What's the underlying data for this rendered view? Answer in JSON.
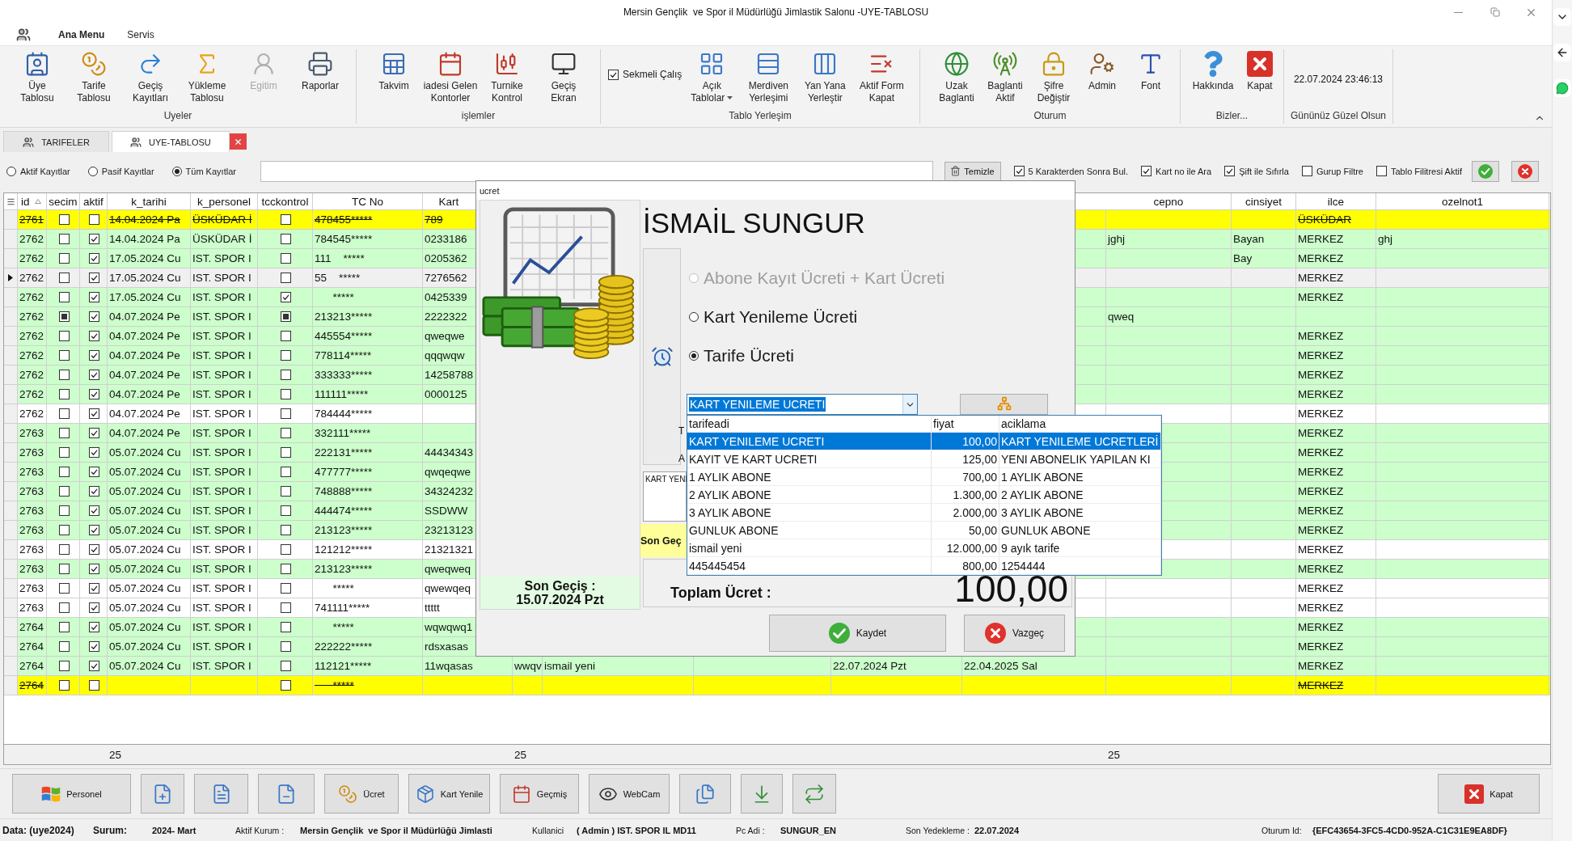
{
  "window": {
    "title": "Mersin Gençlik  ve Spor il Müdürlüğü Jimlastik Salonu -UYE-TABLOSU"
  },
  "menu": [
    {
      "label": "Ana Menu",
      "selected": true
    },
    {
      "label": "Servis",
      "selected": false
    }
  ],
  "ribbon": {
    "groups": [
      {
        "label": "Uyeler",
        "items": [
          {
            "label": "Üye\nTablosu",
            "disabled": false
          },
          {
            "label": "Tarife\nTablosu",
            "disabled": false
          },
          {
            "label": "Geçiş\nKayıtları",
            "disabled": false
          },
          {
            "label": "Yükleme\nTablosu",
            "disabled": false
          },
          {
            "label": "Egitim",
            "disabled": true
          },
          {
            "label": "Raporlar",
            "disabled": false
          }
        ]
      },
      {
        "label": "işlemler",
        "items": [
          {
            "label": "Takvim"
          },
          {
            "label": "iadesi Gelen\nKontorler"
          },
          {
            "label": "Turnike\nKontrol"
          },
          {
            "label": "Geçiş\nEkran"
          }
        ]
      },
      {
        "label": "Tablo Yerleşim",
        "checkbox": {
          "label": "Sekmeli Çalış",
          "checked": true
        },
        "items": [
          {
            "label": "Açık\nTablolar",
            "dropdown": true
          },
          {
            "label": "Merdiven\nYerleşimi",
            "dropdown": false
          },
          {
            "label": "Yan Yana\nYerleştir",
            "dropdown": false
          },
          {
            "label": "Aktif Form\nKapat",
            "dropdown": false
          }
        ]
      },
      {
        "label": "Oturum",
        "items": [
          {
            "label": "Uzak\nBaglanti"
          },
          {
            "label": "Baglanti\nAktif"
          },
          {
            "label": "Şifre\nDeğiştir"
          },
          {
            "label": "Admin"
          },
          {
            "label": "Font"
          }
        ]
      },
      {
        "label": "Bizler...",
        "items": [
          {
            "label": "Hakkında"
          },
          {
            "label": "Kapat"
          }
        ]
      },
      {
        "label": "Gününüz Güzel Olsun",
        "clock": "22.07.2024 23:46:13"
      }
    ]
  },
  "tabs": [
    {
      "label": "TARIFELER",
      "selected": false
    },
    {
      "label": "UYE-TABLOSU",
      "selected": true
    }
  ],
  "filters": {
    "radios": [
      {
        "label": "Aktif Kayıtlar",
        "selected": false
      },
      {
        "label": "Pasif Kayıtlar",
        "selected": false
      },
      {
        "label": "Tüm Kayıtlar",
        "selected": true
      }
    ],
    "clear_button": "Temizle",
    "checkboxes": [
      {
        "label": "5 Karakterden Sonra Bul.",
        "checked": true
      },
      {
        "label": "Kart no ile Ara",
        "checked": true
      },
      {
        "label": "Şift ile Sıfırla",
        "checked": true
      },
      {
        "label": "Gurup Filtre",
        "checked": false
      },
      {
        "label": "Tablo Filitresi Aktif",
        "checked": false
      }
    ]
  },
  "table": {
    "columns": {
      "id": {
        "label": "id",
        "kind": "text",
        "sorted": true
      },
      "secim": {
        "label": "secim",
        "kind": "checkbox"
      },
      "aktif": {
        "label": "aktif",
        "kind": "checkbox"
      },
      "k_tarihi": {
        "label": "k_tarihi",
        "kind": "text",
        "footer": "25"
      },
      "k_personel": {
        "label": "k_personel",
        "kind": "text"
      },
      "tcckontrol": {
        "label": "tcckontrol",
        "kind": "checkbox"
      },
      "tc_no": {
        "label": "TC No",
        "kind": "text"
      },
      "kart": {
        "label": "Kart",
        "kind": "text"
      },
      "column_9": {
        "kind": "text",
        "footer": "25"
      },
      "column_10": {
        "kind": "text"
      },
      "column_11": {
        "kind": "text"
      },
      "column_12": {
        "kind": "text"
      },
      "column_13": {
        "kind": "text"
      },
      "cepno": {
        "label": "cepno",
        "kind": "text",
        "footer": "25"
      },
      "cinsiyet": {
        "label": "cinsiyet",
        "kind": "text"
      },
      "ilce": {
        "label": "ilce",
        "kind": "text"
      },
      "ozelnot1": {
        "label": "ozelnot1",
        "kind": "text"
      }
    },
    "rows": [
      {
        "color": "#ffff00",
        "struck": true,
        "selected": false,
        "cells": {
          "id": "2761",
          "secim": {
            "checked": false
          },
          "aktif": {
            "checked": false
          },
          "k_tarihi": "14.04.2024 Pa",
          "k_personel": "ÜSKÜDAR İ",
          "tcckontrol": {
            "checked": false
          },
          "tc_no": "478455*****",
          "kart": "789",
          "ilce": "ÜSKÜDAR"
        }
      },
      {
        "color": "#ccffcc",
        "struck": false,
        "selected": false,
        "cells": {
          "id": "2762",
          "secim": {
            "checked": false
          },
          "aktif": {
            "checked": true
          },
          "k_tarihi": "14.04.2024 Pa",
          "k_personel": "ÜSKÜDAR İ",
          "tcckontrol": {
            "checked": false
          },
          "tc_no": "784545*****",
          "kart": "0233186",
          "cepno": "jghj",
          "cinsiyet": "Bayan",
          "ilce": "MERKEZ",
          "ozelnot1": "ghj"
        }
      },
      {
        "color": "#ccffcc",
        "struck": false,
        "selected": false,
        "cells": {
          "id": "2762",
          "secim": {
            "checked": false
          },
          "aktif": {
            "checked": true
          },
          "k_tarihi": "17.05.2024 Cu",
          "k_personel": "IST. SPOR I",
          "tcckontrol": {
            "checked": false
          },
          "tc_no": "111    *****",
          "kart": "0205362",
          "cinsiyet": "Bay",
          "ilce": "MERKEZ"
        }
      },
      {
        "color": "#f0f0f0",
        "struck": false,
        "selected": true,
        "cells": {
          "id": "2762",
          "secim": {
            "checked": false
          },
          "aktif": {
            "checked": true
          },
          "k_tarihi": "17.05.2024 Cu",
          "k_personel": "IST. SPOR I",
          "tcckontrol": {
            "checked": false
          },
          "tc_no": "55    *****",
          "kart": "7276562",
          "ilce": "MERKEZ"
        }
      },
      {
        "color": "#ccffcc",
        "struck": false,
        "selected": false,
        "cells": {
          "id": "2762",
          "secim": {
            "checked": false
          },
          "aktif": {
            "checked": true
          },
          "k_tarihi": "17.05.2024 Cu",
          "k_personel": "IST. SPOR I",
          "tcckontrol": {
            "checked": true
          },
          "tc_no": "      *****",
          "kart": "0425339",
          "ilce": "MERKEZ"
        }
      },
      {
        "color": "#ccffcc",
        "struck": false,
        "selected": false,
        "cells": {
          "id": "2762",
          "secim": {
            "checked": true,
            "indeterminate": true
          },
          "aktif": {
            "checked": true
          },
          "k_tarihi": "04.07.2024 Pe",
          "k_personel": "IST. SPOR I",
          "tcckontrol": {
            "checked": true,
            "indeterminate": true
          },
          "tc_no": "213213*****",
          "kart": "2222322",
          "cepno": "qweq"
        }
      },
      {
        "color": "#ccffcc",
        "struck": false,
        "selected": false,
        "cells": {
          "id": "2762",
          "secim": {
            "checked": false
          },
          "aktif": {
            "checked": true
          },
          "k_tarihi": "04.07.2024 Pe",
          "k_personel": "IST. SPOR I",
          "tcckontrol": {
            "checked": false
          },
          "tc_no": "445554*****",
          "kart": "qweqwe",
          "ilce": "MERKEZ"
        }
      },
      {
        "color": "#ccffcc",
        "struck": false,
        "selected": false,
        "cells": {
          "id": "2762",
          "secim": {
            "checked": false
          },
          "aktif": {
            "checked": true
          },
          "k_tarihi": "04.07.2024 Pe",
          "k_personel": "IST. SPOR I",
          "tcckontrol": {
            "checked": false
          },
          "tc_no": "778114*****",
          "kart": "qqqwqw",
          "ilce": "MERKEZ"
        }
      },
      {
        "color": "#ccffcc",
        "struck": false,
        "selected": false,
        "cells": {
          "id": "2762",
          "secim": {
            "checked": false
          },
          "aktif": {
            "checked": true
          },
          "k_tarihi": "04.07.2024 Pe",
          "k_personel": "IST. SPOR I",
          "tcckontrol": {
            "checked": false
          },
          "tc_no": "333333*****",
          "kart": "14258788",
          "ilce": "MERKEZ"
        }
      },
      {
        "color": "#ccffcc",
        "struck": false,
        "selected": false,
        "cells": {
          "id": "2762",
          "secim": {
            "checked": false
          },
          "aktif": {
            "checked": true
          },
          "k_tarihi": "04.07.2024 Pe",
          "k_personel": "IST. SPOR I",
          "tcckontrol": {
            "checked": false
          },
          "tc_no": "111111*****",
          "kart": "0000125",
          "ilce": "MERKEZ"
        }
      },
      {
        "color": "#ffffff",
        "struck": false,
        "selected": false,
        "cells": {
          "id": "2762",
          "secim": {
            "checked": false
          },
          "aktif": {
            "checked": true
          },
          "k_tarihi": "04.07.2024 Pe",
          "k_personel": "IST. SPOR I",
          "tcckontrol": {
            "checked": false
          },
          "tc_no": "784444*****",
          "ilce": "MERKEZ"
        }
      },
      {
        "color": "#ccffcc",
        "struck": false,
        "selected": false,
        "cells": {
          "id": "2763",
          "secim": {
            "checked": false
          },
          "aktif": {
            "checked": true
          },
          "k_tarihi": "04.07.2024 Pe",
          "k_personel": "IST. SPOR I",
          "tcckontrol": {
            "checked": false
          },
          "tc_no": "332111*****",
          "ilce": "MERKEZ"
        }
      },
      {
        "color": "#ccffcc",
        "struck": false,
        "selected": false,
        "cells": {
          "id": "2763",
          "secim": {
            "checked": false
          },
          "aktif": {
            "checked": true
          },
          "k_tarihi": "05.07.2024 Cu",
          "k_personel": "IST. SPOR I",
          "tcckontrol": {
            "checked": false
          },
          "tc_no": "222131*****",
          "kart": "44434343",
          "ilce": "MERKEZ"
        }
      },
      {
        "color": "#ccffcc",
        "struck": false,
        "selected": false,
        "cells": {
          "id": "2763",
          "secim": {
            "checked": false
          },
          "aktif": {
            "checked": true
          },
          "k_tarihi": "05.07.2024 Cu",
          "k_personel": "IST. SPOR I",
          "tcckontrol": {
            "checked": false
          },
          "tc_no": "477777*****",
          "kart": "qwqeqwe",
          "ilce": "MERKEZ"
        }
      },
      {
        "color": "#ccffcc",
        "struck": false,
        "selected": false,
        "cells": {
          "id": "2763",
          "secim": {
            "checked": false
          },
          "aktif": {
            "checked": true
          },
          "k_tarihi": "05.07.2024 Cu",
          "k_personel": "IST. SPOR I",
          "tcckontrol": {
            "checked": false
          },
          "tc_no": "748888*****",
          "kart": "34324232",
          "ilce": "MERKEZ"
        }
      },
      {
        "color": "#ccffcc",
        "struck": false,
        "selected": false,
        "cells": {
          "id": "2763",
          "secim": {
            "checked": false
          },
          "aktif": {
            "checked": true
          },
          "k_tarihi": "05.07.2024 Cu",
          "k_personel": "IST. SPOR I",
          "tcckontrol": {
            "checked": false
          },
          "tc_no": "444474*****",
          "kart": "SSDWW",
          "ilce": "MERKEZ"
        }
      },
      {
        "color": "#ccffcc",
        "struck": false,
        "selected": false,
        "cells": {
          "id": "2763",
          "secim": {
            "checked": false
          },
          "aktif": {
            "checked": true
          },
          "k_tarihi": "05.07.2024 Cu",
          "k_personel": "IST. SPOR I",
          "tcckontrol": {
            "checked": false
          },
          "tc_no": "213123*****",
          "kart": "23213123",
          "ilce": "MERKEZ"
        }
      },
      {
        "color": "#ffffff",
        "struck": false,
        "selected": false,
        "cells": {
          "id": "2763",
          "secim": {
            "checked": false
          },
          "aktif": {
            "checked": true
          },
          "k_tarihi": "05.07.2024 Cu",
          "k_personel": "IST. SPOR I",
          "tcckontrol": {
            "checked": false
          },
          "tc_no": "121212*****",
          "kart": "21321321",
          "ilce": "MERKEZ"
        }
      },
      {
        "color": "#ccffcc",
        "struck": false,
        "selected": false,
        "cells": {
          "id": "2763",
          "secim": {
            "checked": false
          },
          "aktif": {
            "checked": true
          },
          "k_tarihi": "05.07.2024 Cu",
          "k_personel": "IST. SPOR I",
          "tcckontrol": {
            "checked": false
          },
          "tc_no": "213123*****",
          "kart": "qweqweq",
          "ilce": "MERKEZ"
        }
      },
      {
        "color": "#ffffff",
        "struck": false,
        "selected": false,
        "cells": {
          "id": "2763",
          "secim": {
            "checked": false
          },
          "aktif": {
            "checked": true
          },
          "k_tarihi": "05.07.2024 Cu",
          "k_personel": "IST. SPOR I",
          "tcckontrol": {
            "checked": false
          },
          "tc_no": "      *****",
          "kart": "qwewqeq",
          "ilce": "MERKEZ"
        }
      },
      {
        "color": "#ffffff",
        "struck": false,
        "selected": false,
        "cells": {
          "id": "2763",
          "secim": {
            "checked": false
          },
          "aktif": {
            "checked": true
          },
          "k_tarihi": "05.07.2024 Cu",
          "k_personel": "IST. SPOR I",
          "tcckontrol": {
            "checked": false
          },
          "tc_no": "741111*****",
          "kart": "ttttt",
          "ilce": "MERKEZ"
        }
      },
      {
        "color": "#ccffcc",
        "struck": false,
        "selected": false,
        "cells": {
          "id": "2764",
          "secim": {
            "checked": false
          },
          "aktif": {
            "checked": true
          },
          "k_tarihi": "05.07.2024 Cu",
          "k_personel": "IST. SPOR I",
          "tcckontrol": {
            "checked": false
          },
          "tc_no": "      *****",
          "kart": "wqwqwq1",
          "ilce": "MERKEZ"
        }
      },
      {
        "color": "#ccffcc",
        "struck": false,
        "selected": false,
        "cells": {
          "id": "2764",
          "secim": {
            "checked": false
          },
          "aktif": {
            "checked": true
          },
          "k_tarihi": "05.07.2024 Cu",
          "k_personel": "IST. SPOR I",
          "tcckontrol": {
            "checked": false
          },
          "tc_no": "222222*****",
          "kart": "rdsxasas",
          "ilce": "MERKEZ"
        }
      },
      {
        "color": "#ccffcc",
        "struck": false,
        "selected": false,
        "cells": {
          "id": "2764",
          "secim": {
            "checked": false
          },
          "aktif": {
            "checked": true
          },
          "k_tarihi": "05.07.2024 Cu",
          "k_personel": "IST. SPOR I",
          "tcckontrol": {
            "checked": false
          },
          "tc_no": "112121*****",
          "kart": "11wqasas",
          "column_9": "wwqv",
          "column_10": "ismail yeni",
          "column_12": "22.07.2024 Pzt",
          "column_13": "22.04.2025 Sal",
          "ilce": "MERKEZ"
        }
      },
      {
        "color": "#ffff00",
        "struck": true,
        "selected": false,
        "cells": {
          "id": "2764",
          "secim": {
            "checked": false
          },
          "aktif": {
            "checked": false
          },
          "tcckontrol": {
            "checked": false
          },
          "tc_no": "      *****",
          "ilce": "MERKEZ"
        }
      }
    ]
  },
  "dialog": {
    "title": "ucret",
    "last_pass": {
      "label": "Son Geçiş :",
      "date": "15.07.2024 Pzt"
    },
    "name": "İSMAİL SUNGUR",
    "options": [
      {
        "label": "Abone Kayıt Ücreti + Kart Ücreti",
        "selected": false,
        "disabled": true
      },
      {
        "label": "Kart Yenileme Ücreti",
        "selected": false,
        "disabled": false
      },
      {
        "label": "Tarife Ücreti",
        "selected": true,
        "disabled": false
      }
    ],
    "tariff": {
      "value": "KART YENILEME UCRETI",
      "expanded": true
    },
    "labels": [
      "T",
      "A"
    ],
    "note": "KART YENI",
    "last_pass_short": "Son Geç",
    "total": {
      "label": "Toplam Ücret :",
      "value": "100,00"
    },
    "tariff_list": {
      "columns": [
        "tarifeadi",
        "fiyat",
        "aciklama"
      ],
      "rows": [
        {
          "cells": [
            "KART YENILEME UCRETI",
            "100,00",
            "KART YENILEME UCRETLERİ"
          ],
          "selected": true
        },
        {
          "cells": [
            "KAYIT VE KART UCRETI",
            "125,00",
            "YENI ABONELIK YAPILAN KI"
          ],
          "selected": false
        },
        {
          "cells": [
            "1 AYLIK ABONE",
            "700,00",
            "1 AYLIK ABONE"
          ],
          "selected": false
        },
        {
          "cells": [
            "2 AYLIK ABONE",
            "1.300,00",
            "2 AYLIK ABONE"
          ],
          "selected": false
        },
        {
          "cells": [
            "3 AYLIK ABONE",
            "2.000,00",
            "3 AYLIK ABONE"
          ],
          "selected": false
        },
        {
          "cells": [
            "GUNLUK ABONE",
            "50,00",
            "GUNLUK ABONE"
          ],
          "selected": false
        },
        {
          "cells": [
            "ismail yeni",
            "12.000,00",
            "9 ayık tarife"
          ],
          "selected": false
        },
        {
          "cells": [
            "445445454",
            "800,00",
            "1254444"
          ],
          "selected": false
        }
      ]
    },
    "buttons": [
      {
        "label": "Kaydet",
        "kind": "save"
      },
      {
        "label": "Vazgeç",
        "kind": "cancel"
      }
    ]
  },
  "toolbar": {
    "buttons": [
      {
        "kind": "labeled",
        "label": "Personel"
      },
      {
        "kind": "icon"
      },
      {
        "kind": "icon"
      },
      {
        "kind": "icon"
      },
      {
        "kind": "labeled",
        "label": "Ücret"
      },
      {
        "kind": "labeled",
        "label": "Kart Yenile"
      },
      {
        "kind": "labeled",
        "label": "Geçmiş"
      },
      {
        "kind": "labeled",
        "label": "WebCam"
      },
      {
        "kind": "icon"
      },
      {
        "kind": "icon"
      },
      {
        "kind": "icon"
      },
      {
        "kind": "labeled",
        "label": "Kapat"
      }
    ]
  },
  "status_bar": [
    {
      "kind": "title",
      "text": "Data: (uye2024)"
    },
    {
      "kind": "title",
      "text": "Surum:"
    },
    {
      "kind": "value",
      "text": "2024- Mart"
    },
    {
      "kind": "label",
      "text": "Aktif Kurum :"
    },
    {
      "kind": "value",
      "text": "Mersin Gençlik  ve Spor il Müdürlüğü Jimlasti"
    },
    {
      "kind": "label",
      "text": "Kullanici"
    },
    {
      "kind": "value",
      "text": "( Admin ) IST. SPOR IL MD11"
    },
    {
      "kind": "label",
      "text": "Pc Adi :"
    },
    {
      "kind": "value",
      "text": "SUNGUR_EN"
    },
    {
      "kind": "label",
      "text": "Son Yedekleme :"
    },
    {
      "kind": "value",
      "text": "22.07.2024"
    },
    {
      "kind": "label",
      "text": "Oturum Id:"
    },
    {
      "kind": "value",
      "text": "{EFC43654-3FC5-4CD0-952A-C1C31E9EA8DF}"
    }
  ]
}
